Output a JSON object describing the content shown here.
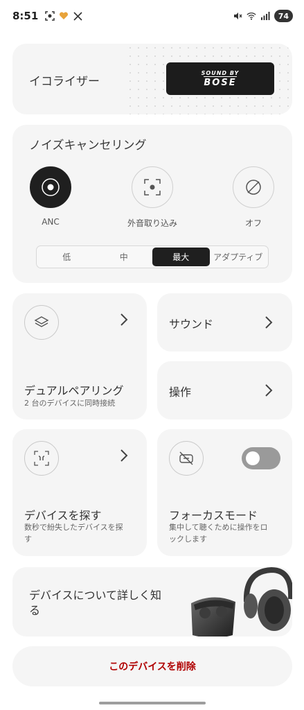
{
  "status_bar": {
    "time": "8:51",
    "battery": "74",
    "left_icons": [
      "screenshot-icon",
      "heart-icon",
      "x-icon"
    ],
    "right_icons": [
      "mute-icon",
      "wifi-icon",
      "signal-icon"
    ]
  },
  "equalizer": {
    "label": "イコライザー",
    "badge_top": "SOUND BY",
    "badge_main": "BOSE"
  },
  "noise_cancelling": {
    "title": "ノイズキャンセリング",
    "modes": [
      {
        "label": "ANC",
        "active": true
      },
      {
        "label": "外音取り込み",
        "active": false
      },
      {
        "label": "オフ",
        "active": false
      }
    ],
    "levels": [
      "低",
      "中",
      "最大",
      "アダプティブ"
    ],
    "selected_level": "最大"
  },
  "dual_pairing": {
    "title": "デュアルペアリング",
    "subtitle": "2 台のデバイスに同時接続"
  },
  "sound": {
    "title": "サウンド"
  },
  "controls": {
    "title": "操作"
  },
  "find_device": {
    "title": "デバイスを探す",
    "subtitle_line1": "数秒で紛失したデバイスを探",
    "subtitle_line2": "す"
  },
  "focus_mode": {
    "title": "フォーカスモード",
    "subtitle_line1": "集中して聴くために操作をロ",
    "subtitle_line2": "ックします",
    "enabled": false
  },
  "learn_more": {
    "line1": "デバイスについて詳しく知",
    "line2": "る"
  },
  "delete": {
    "label": "このデバイスを削除"
  },
  "colors": {
    "accent": "#1f1f1f",
    "danger": "#b00000",
    "card": "#f5f5f5"
  }
}
